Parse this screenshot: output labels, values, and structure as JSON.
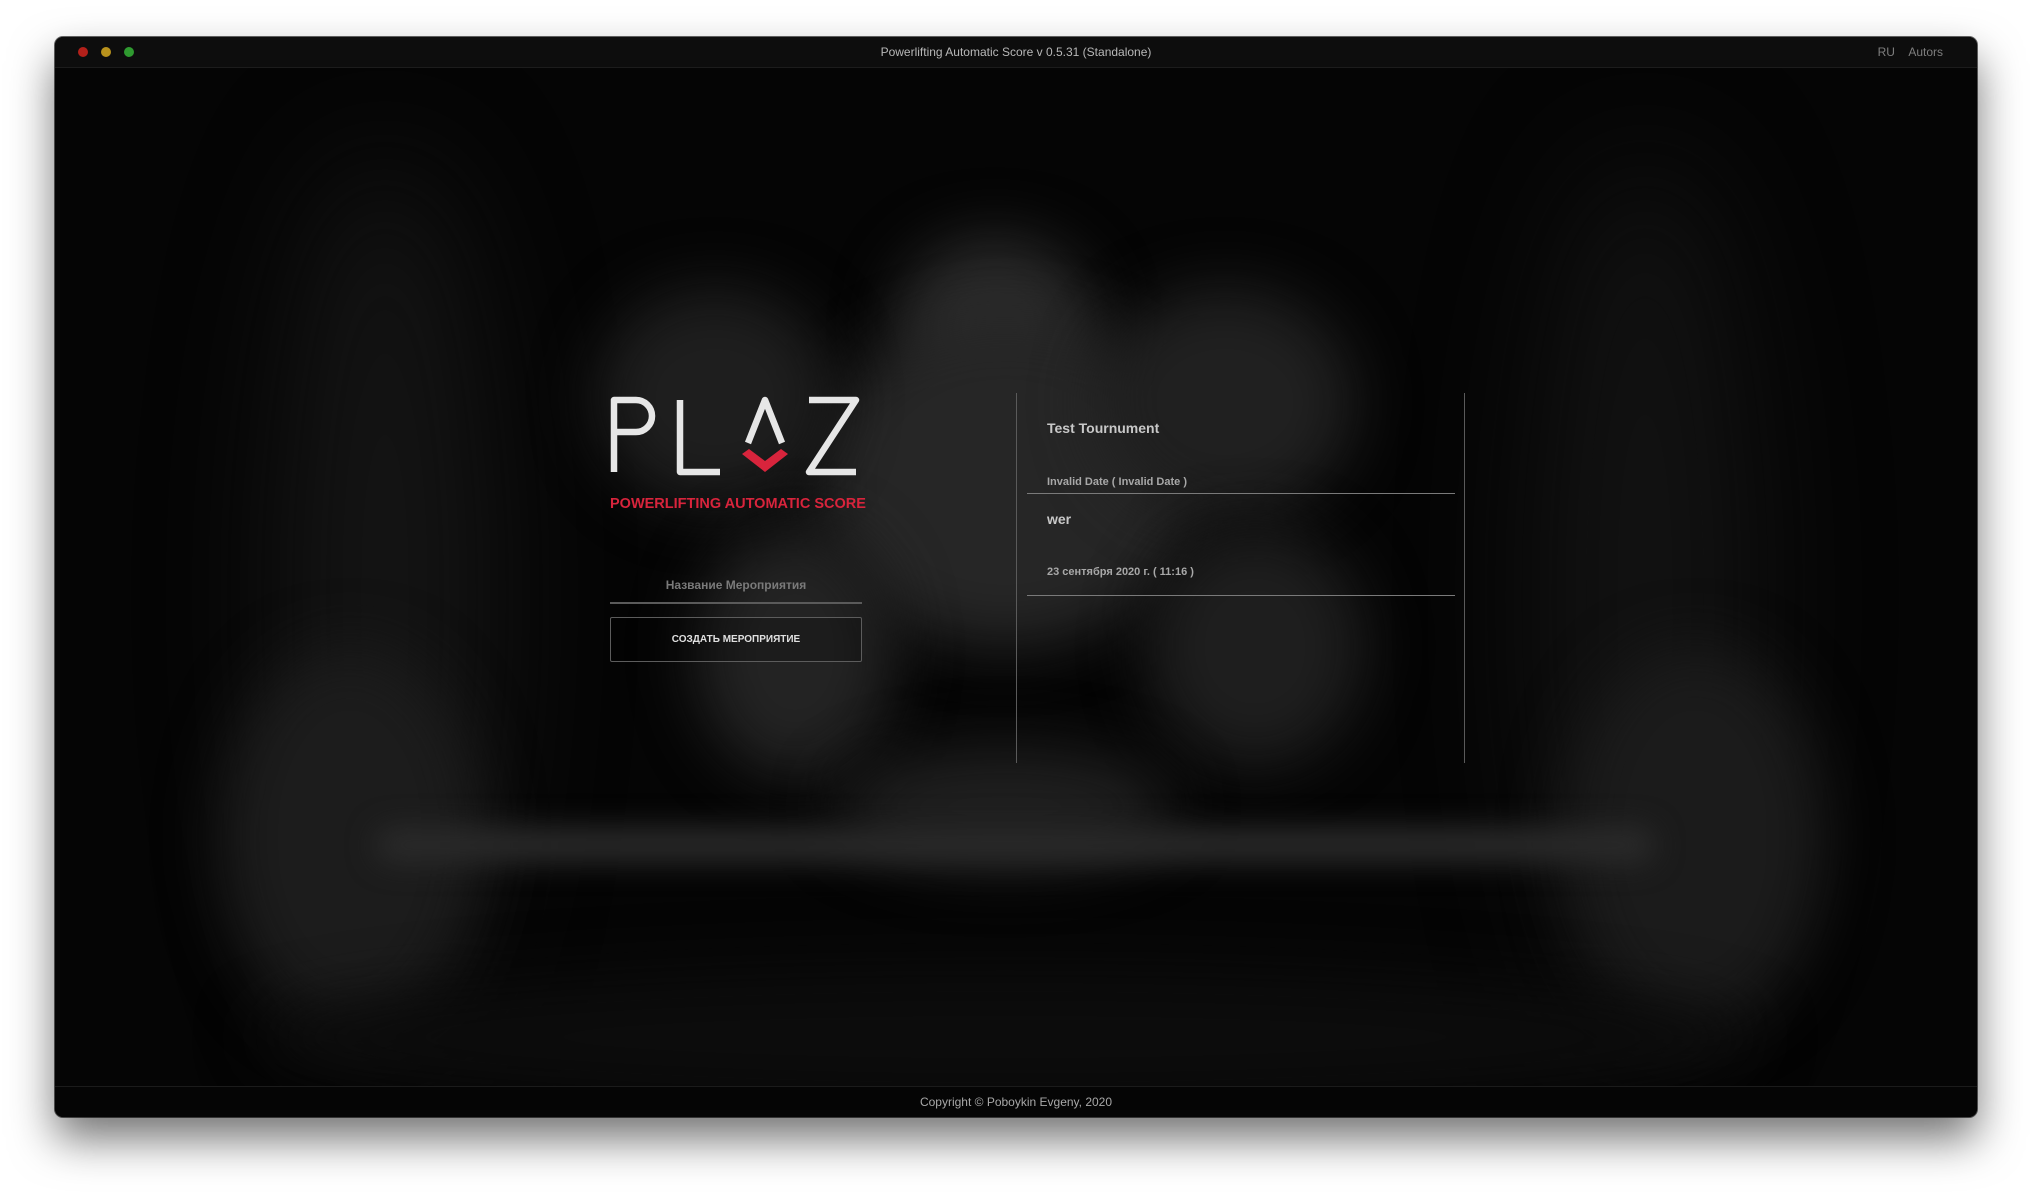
{
  "window": {
    "title": "Powerlifting Automatic Score v 0.5.31 (Standalone)",
    "lang": "RU",
    "authors": "Autors"
  },
  "logo": {
    "letters": "PLAS",
    "subtitle": "POWERLIFTING AUTOMATIC SCORE",
    "accent_color": "#d8243c"
  },
  "create_form": {
    "input_placeholder": "Название Мероприятия",
    "input_value": "",
    "button_label": "СОЗДАТЬ МЕРОПРИЯТИЕ"
  },
  "tournaments": [
    {
      "name": "Test Tournument",
      "date": "Invalid Date ( Invalid Date )"
    },
    {
      "name": "wer",
      "date": "23 сентября 2020 г. ( 11:16 )"
    }
  ],
  "footer": {
    "copyright": "Copyright © Poboykin Evgeny, 2020"
  }
}
